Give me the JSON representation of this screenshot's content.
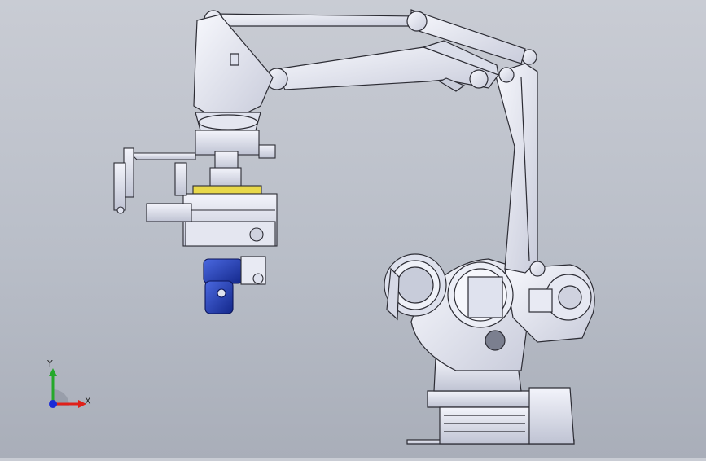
{
  "triad": {
    "x_label": "X",
    "y_label": "Y"
  },
  "colors": {
    "background_top": "#c9ccd4",
    "background_bottom": "#a9aeb9",
    "model_body": "#eef0f8",
    "model_shade": "#c7cad8",
    "model_outline": "#2c2c34",
    "motor_blue": "#1f3fb0",
    "gripper_plate": "#e8d84a",
    "axis_x": "#e0201a",
    "axis_y": "#25a82a",
    "axis_z": "#1a2ad8"
  }
}
